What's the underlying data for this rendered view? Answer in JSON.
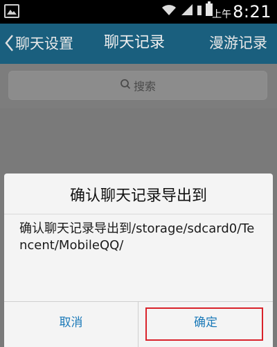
{
  "status_bar": {
    "ampm": "上午",
    "time": "8:21",
    "icons": [
      "gallery-icon",
      "wifi-icon",
      "signal-icon",
      "sim-icon",
      "battery-icon"
    ]
  },
  "title_bar": {
    "back_label": "聊天设置",
    "title": "聊天记录",
    "right_label": "漫游记录"
  },
  "search": {
    "label": "搜索"
  },
  "dialog": {
    "title": "确认聊天记录导出到",
    "message": "确认聊天记录导出到/storage/sdcard0/Tencent/MobileQQ/",
    "cancel_label": "取消",
    "confirm_label": "确定"
  },
  "colors": {
    "title_bar_bg": "#1a5f7e",
    "button_text": "#1a79b8",
    "highlight_border": "#d9222a"
  }
}
